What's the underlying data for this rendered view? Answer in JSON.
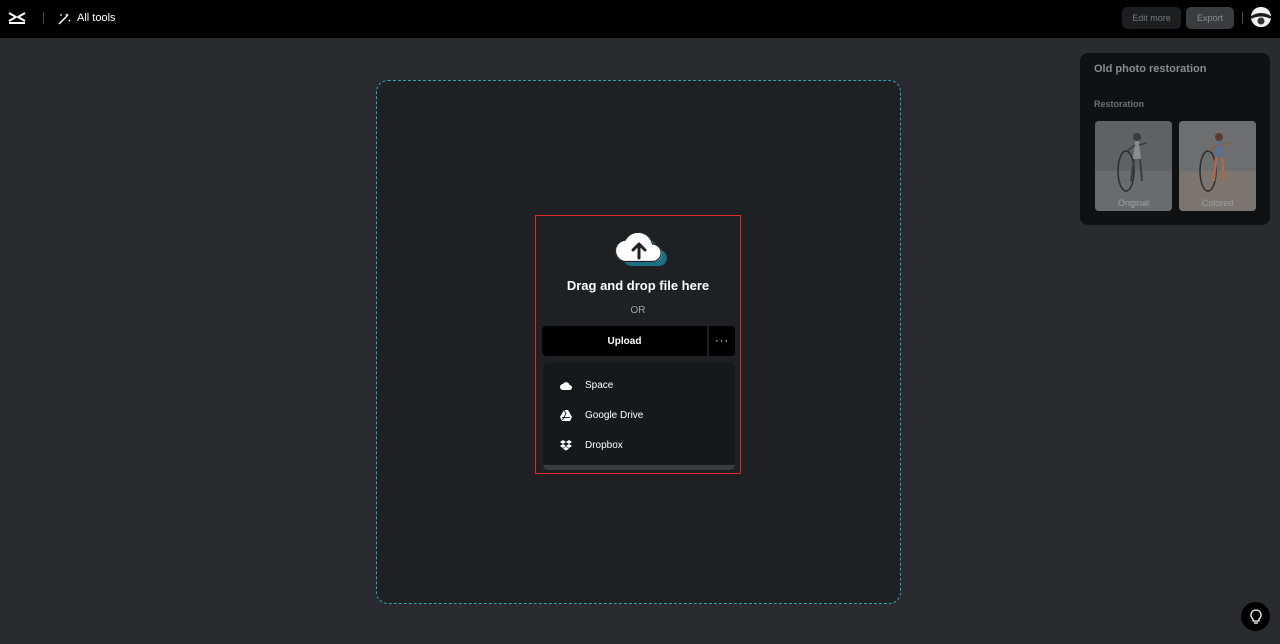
{
  "topbar": {
    "logo_icon": "capcut-logo-icon",
    "all_tools_label": "All tools",
    "edit_more_label": "Edit more",
    "export_label": "Export"
  },
  "upload": {
    "icon": "cloud-upload-icon",
    "drag_text": "Drag and drop file here",
    "or_text": "OR",
    "upload_label": "Upload",
    "more_label": "···",
    "menu": [
      {
        "label": "Space",
        "icon": "cloud-icon"
      },
      {
        "label": "Google Drive",
        "icon": "google-drive-icon"
      },
      {
        "label": "Dropbox",
        "icon": "dropbox-icon"
      }
    ]
  },
  "side_panel": {
    "title": "Old photo restoration",
    "section": "Restoration",
    "thumbs": [
      {
        "caption": "Original"
      },
      {
        "caption": "Colored"
      }
    ]
  },
  "colors": {
    "accent": "#2ba6b8",
    "highlight": "#e02a30",
    "background": "#2a2b2f"
  }
}
